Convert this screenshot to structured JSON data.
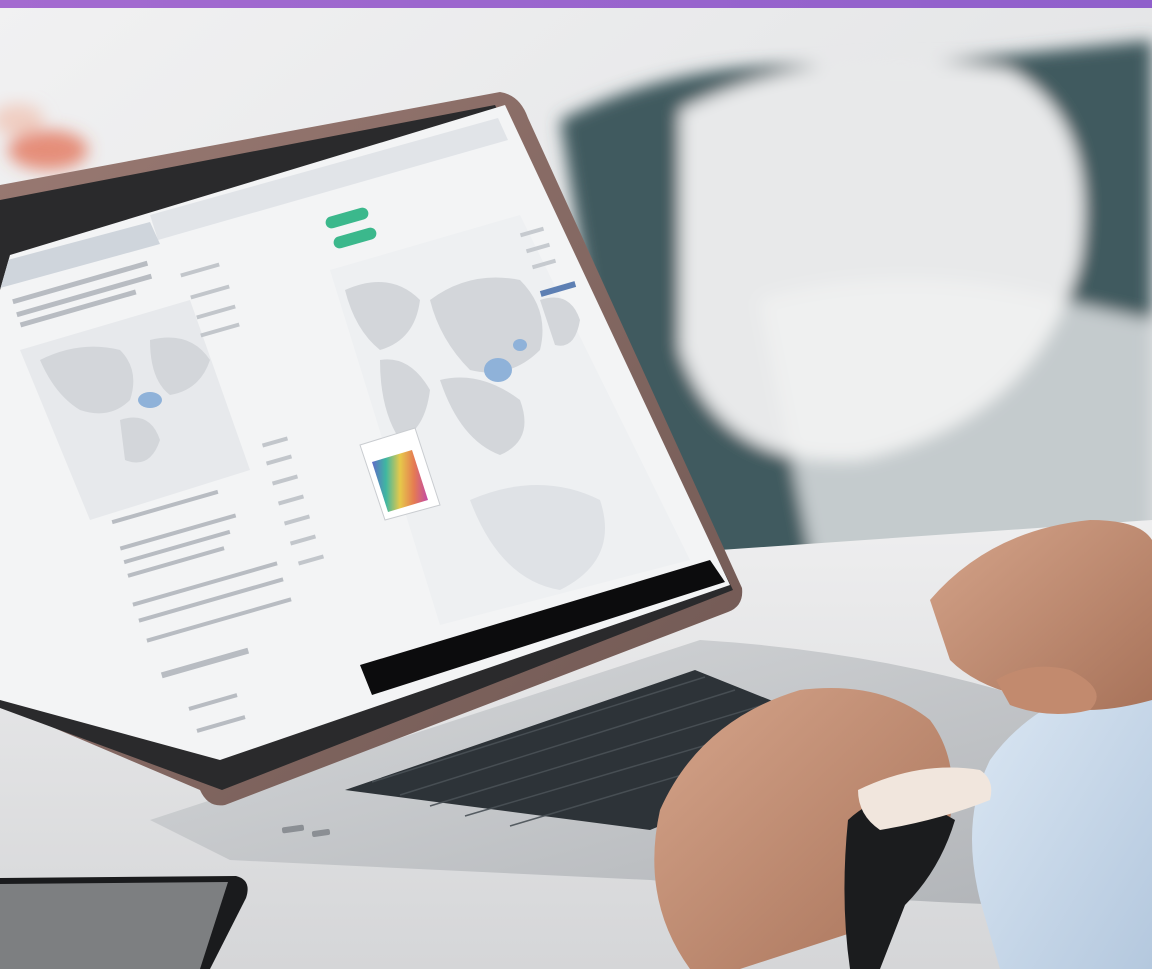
{
  "scene": {
    "subject": "laptop-on-desk",
    "colors": {
      "top_band": "#a46bd0",
      "top_band_end": "#8f5fcb",
      "background_wall": "#e7e7e8",
      "sofa": "#3f5a5f",
      "desk": "#e9eaec",
      "laptop_shell": "#8c6f6a",
      "laptop_base": "#c7c9cc",
      "keyboard": "#2d3338",
      "screen_bg": "#f3f4f5",
      "map_land": "#d3d6da",
      "map_highlight": "#8fb2d9",
      "accent_green": "#3bb88c",
      "skin": "#c79478",
      "sleeve": "#cfdff0",
      "watch_band": "#1b1c1e",
      "watch_face": "#f1e6dd",
      "phone": "#1a1b1d"
    }
  },
  "icons": {
    "sofa": "sofa-icon",
    "watch": "watch-icon",
    "phone": "phone-icon",
    "map": "world-map-icon",
    "palette": "color-palette-icon"
  }
}
